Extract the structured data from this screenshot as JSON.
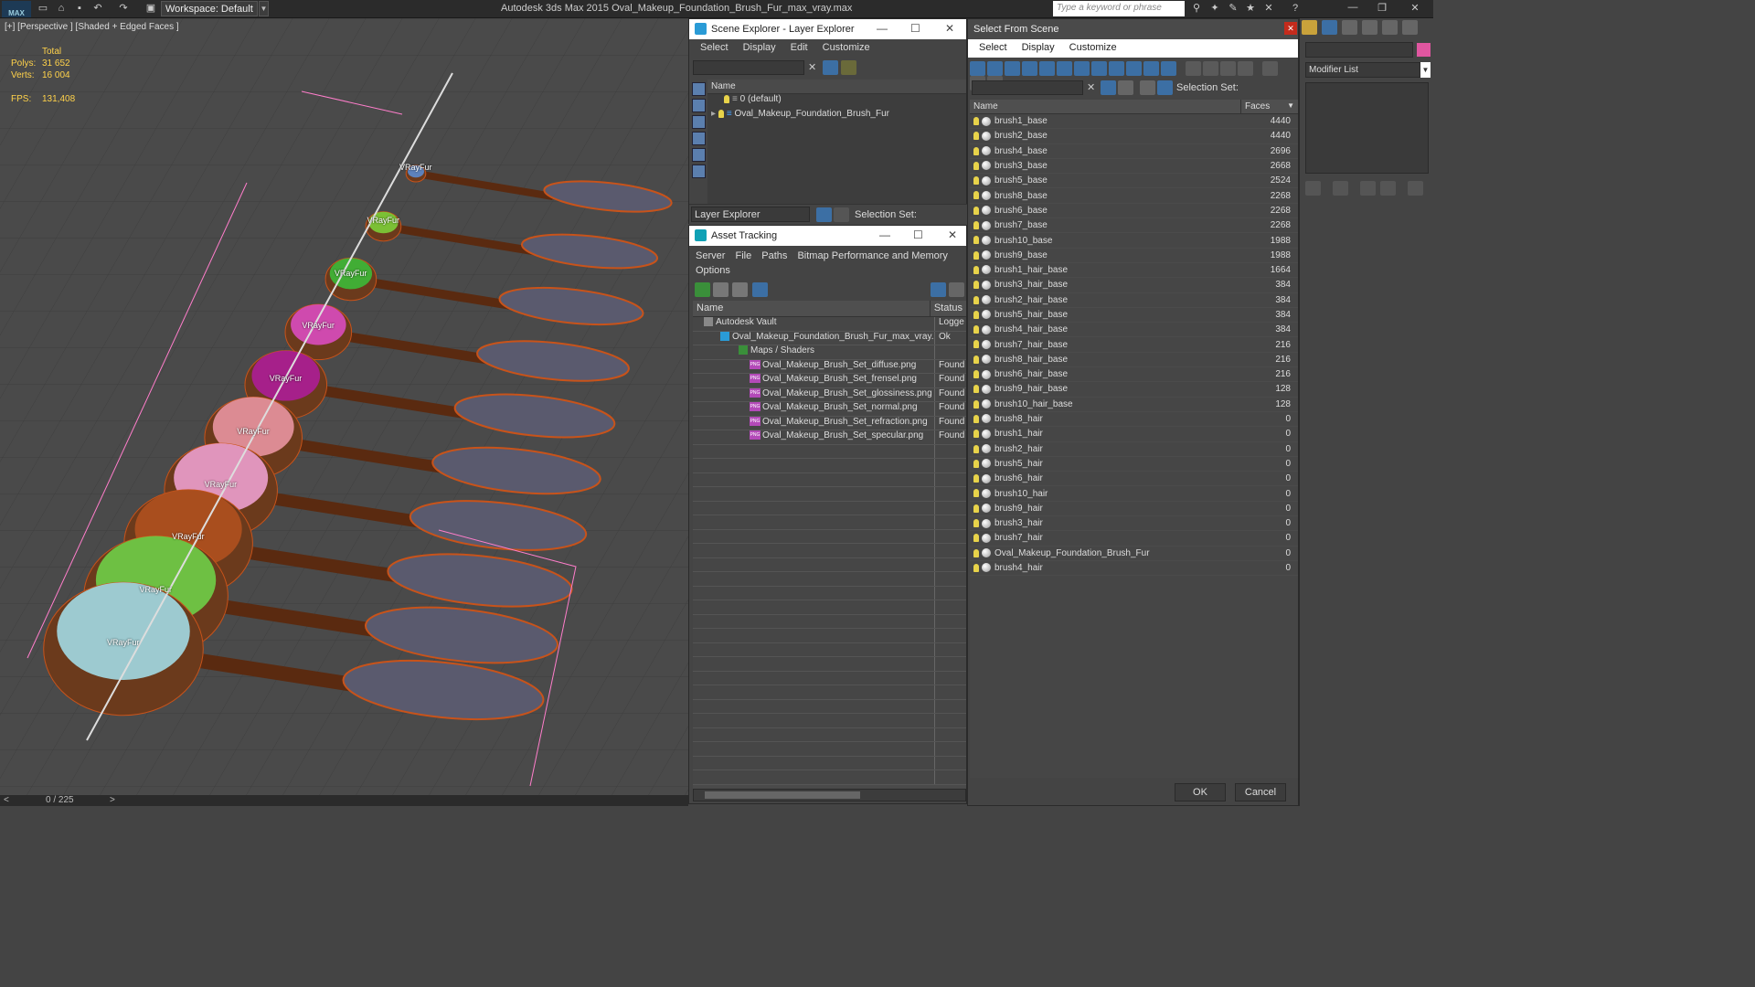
{
  "app": {
    "title": "Autodesk 3ds Max  2015    Oval_Makeup_Foundation_Brush_Fur_max_vray.max",
    "logo": "MAX",
    "workspace": "Workspace: Default",
    "search_placeholder": "Type a keyword or phrase"
  },
  "viewport": {
    "label": "[+] [Perspective ] [Shaded + Edged Faces ]",
    "stats": {
      "total_label": "Total",
      "polys_label": "Polys:",
      "polys_value": "31 652",
      "verts_label": "Verts:",
      "verts_value": "16 004",
      "fps_label": "FPS:",
      "fps_value": "131,408"
    },
    "vrayfur_label": "VRayFur",
    "timeline": "0 / 225"
  },
  "scene_explorer": {
    "title": "Scene Explorer - Layer Explorer",
    "menu": [
      "Select",
      "Display",
      "Edit",
      "Customize"
    ],
    "col_name": "Name",
    "rows": [
      "0 (default)",
      "Oval_Makeup_Foundation_Brush_Fur"
    ],
    "footer_label": "Layer Explorer",
    "selection_set_label": "Selection Set:"
  },
  "asset_tracking": {
    "title": "Asset Tracking",
    "menu": [
      "Server",
      "File",
      "Paths",
      "Bitmap Performance and Memory",
      "Options"
    ],
    "col_name": "Name",
    "col_status": "Status",
    "rows": [
      {
        "name": "Autodesk Vault",
        "status": "Logge"
      },
      {
        "name": "Oval_Makeup_Foundation_Brush_Fur_max_vray....",
        "status": "Ok"
      },
      {
        "name": "Maps / Shaders",
        "status": ""
      },
      {
        "name": "Oval_Makeup_Brush_Set_diffuse.png",
        "status": "Found"
      },
      {
        "name": "Oval_Makeup_Brush_Set_frensel.png",
        "status": "Found"
      },
      {
        "name": "Oval_Makeup_Brush_Set_glossiness.png",
        "status": "Found"
      },
      {
        "name": "Oval_Makeup_Brush_Set_normal.png",
        "status": "Found"
      },
      {
        "name": "Oval_Makeup_Brush_Set_refraction.png",
        "status": "Found"
      },
      {
        "name": "Oval_Makeup_Brush_Set_specular.png",
        "status": "Found"
      }
    ],
    "png_badge": "PNG"
  },
  "select_from_scene": {
    "title": "Select From Scene",
    "menu": [
      "Select",
      "Display",
      "Customize"
    ],
    "selection_set_label": "Selection Set:",
    "col_name": "Name",
    "col_faces": "Faces",
    "rows": [
      {
        "name": "brush1_base",
        "faces": "4440"
      },
      {
        "name": "brush2_base",
        "faces": "4440"
      },
      {
        "name": "brush4_base",
        "faces": "2696"
      },
      {
        "name": "brush3_base",
        "faces": "2668"
      },
      {
        "name": "brush5_base",
        "faces": "2524"
      },
      {
        "name": "brush8_base",
        "faces": "2268"
      },
      {
        "name": "brush6_base",
        "faces": "2268"
      },
      {
        "name": "brush7_base",
        "faces": "2268"
      },
      {
        "name": "brush10_base",
        "faces": "1988"
      },
      {
        "name": "brush9_base",
        "faces": "1988"
      },
      {
        "name": "brush1_hair_base",
        "faces": "1664"
      },
      {
        "name": "brush3_hair_base",
        "faces": "384"
      },
      {
        "name": "brush2_hair_base",
        "faces": "384"
      },
      {
        "name": "brush5_hair_base",
        "faces": "384"
      },
      {
        "name": "brush4_hair_base",
        "faces": "384"
      },
      {
        "name": "brush7_hair_base",
        "faces": "216"
      },
      {
        "name": "brush8_hair_base",
        "faces": "216"
      },
      {
        "name": "brush6_hair_base",
        "faces": "216"
      },
      {
        "name": "brush9_hair_base",
        "faces": "128"
      },
      {
        "name": "brush10_hair_base",
        "faces": "128"
      },
      {
        "name": "brush8_hair",
        "faces": "0"
      },
      {
        "name": "brush1_hair",
        "faces": "0"
      },
      {
        "name": "brush2_hair",
        "faces": "0"
      },
      {
        "name": "brush5_hair",
        "faces": "0"
      },
      {
        "name": "brush6_hair",
        "faces": "0"
      },
      {
        "name": "brush10_hair",
        "faces": "0"
      },
      {
        "name": "brush9_hair",
        "faces": "0"
      },
      {
        "name": "brush3_hair",
        "faces": "0"
      },
      {
        "name": "brush7_hair",
        "faces": "0"
      },
      {
        "name": "Oval_Makeup_Foundation_Brush_Fur",
        "faces": "0"
      },
      {
        "name": "brush4_hair",
        "faces": "0"
      }
    ],
    "ok_label": "OK",
    "cancel_label": "Cancel"
  },
  "command_panel": {
    "modifier_list": "Modifier List"
  },
  "colors": {
    "accent_blue": "#2a9bd6",
    "stats_yellow": "#ffd24a",
    "wire_orange": "#c8531a",
    "close_red": "#c42b1c"
  }
}
